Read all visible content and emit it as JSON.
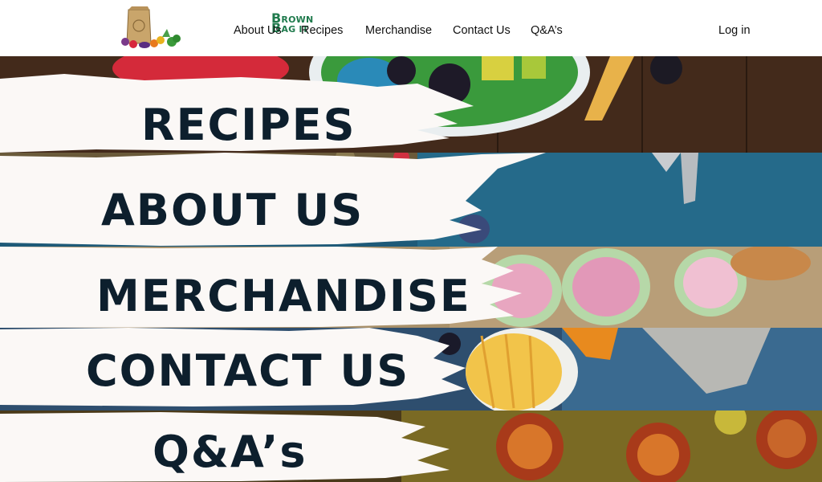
{
  "header": {
    "logo": {
      "line1": "ROWN",
      "line2": "AG IT",
      "initial1": "B",
      "initial2": "B"
    },
    "nav": {
      "about": "About Us",
      "recipes": "Recipes",
      "merchandise": "Merchandise",
      "contact": "Contact Us",
      "qa": "Q&A’s"
    },
    "login": "Log in"
  },
  "bands": {
    "recipes": "RECIPES",
    "about": "ABOUT US",
    "merchandise": "MERCHANDISE",
    "contact": "CONTACT US",
    "qa": "Q&A’s"
  },
  "colors": {
    "brush": "#fbf8f6",
    "label": "#0d1f2d",
    "brand_green": "#1f7a4c"
  },
  "icons": {
    "logo": "paper-bag-with-vegetables-icon"
  }
}
